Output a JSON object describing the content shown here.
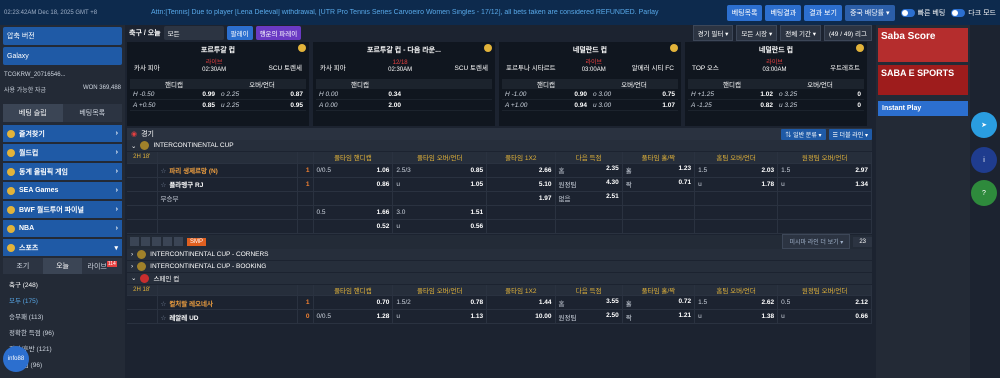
{
  "topbar": {
    "clock": "02:23:42AM Dec 18, 2025 GMT +8",
    "ticker": "Attn:[Tennis] Due to player [Lena Deleval] withdrawal, [UTR Pro Tennis Series Carvoeiro Women Singles - 17/12], all bets taken are considered REFUNDED. Parlay",
    "btns": [
      "베팅목록",
      "베팅결과",
      "결과 보기",
      "중국 배당률 ▾"
    ],
    "toggle1": "빠른 베팅",
    "toggle2": "다크 모드"
  },
  "sidebar": {
    "compress": "압축 버전",
    "galaxy": "Galaxy",
    "user": "TCGKRW_20716546...",
    "balance_label": "사용 가능한 자금",
    "balance": "WON 369,488",
    "tab1": "베팅 슬립",
    "tab2": "베팅목록",
    "menu": [
      "즐겨찾기",
      "월드컵",
      "동계 올림픽 게임",
      "SEA Games",
      "BWF 월드투어 파이널",
      "NBA",
      "스포츠"
    ],
    "subtabs": [
      "조기",
      "오늘",
      "라이브"
    ],
    "live_count": "114",
    "sub": [
      "축구 (248)",
      "모두 (175)",
      "승무패 (113)",
      "정확한 득점 (96)",
      "전반/후반 (121)",
      "홀 득점 (96)"
    ]
  },
  "center": {
    "sport": "축구 / 오늘",
    "filter": "모든",
    "pills": [
      "팔레이",
      "행운의 파레이"
    ],
    "right": [
      "경기 필터 ▾",
      "모든 시장 ▾",
      "전체 기간 ▾",
      "(49 / 49) 리그"
    ],
    "cards": [
      {
        "league": "포르투갈 컵",
        "home": "카사 피아",
        "away": "SCU 토렌세",
        "status": "라이브",
        "time": "02:30AM",
        "hd1": "핸디캡",
        "hd2": "오버/언더",
        "r1": [
          "H -0.50",
          "0.99",
          "o 2.25",
          "0.87"
        ],
        "r2": [
          "A +0.50",
          "0.85",
          "u 2.25",
          "0.95"
        ]
      },
      {
        "league": "포르투갈 컵 - 다음 라운...",
        "home": "카사 피아",
        "away": "SCU 토렌세",
        "status": "12/18",
        "time": "02:30AM",
        "hd1": "핸디캡",
        "hd2": "",
        "r1": [
          "H 0.00",
          "0.34",
          "",
          ""
        ],
        "r2": [
          "A 0.00",
          "2.00",
          "",
          ""
        ]
      },
      {
        "league": "네덜란드 컵",
        "home": "포르투나 시타르트",
        "away": "알메러 시티 FC",
        "status": "라이브",
        "time": "03:00AM",
        "hd1": "핸디캡",
        "hd2": "오버/언더",
        "r1": [
          "H -1.00",
          "0.90",
          "o 3.00",
          "0.75"
        ],
        "r2": [
          "A +1.00",
          "0.94",
          "u 3.00",
          "1.07"
        ]
      },
      {
        "league": "네덜란드 컵",
        "home": "TOP 오스",
        "away": "우트레흐트",
        "status": "라이브",
        "time": "03:00AM",
        "hd1": "핸디캡",
        "hd2": "오버/언더",
        "r1": [
          "H +1.25",
          "1.02",
          "o 3.25",
          "0"
        ],
        "r2": [
          "A -1.25",
          "0.82",
          "u 3.25",
          "0"
        ]
      }
    ],
    "section": "경기",
    "sort1": "⇅ 일반 분류 ▾",
    "sort2": "☰ 더블 라인 ▾",
    "leagues": [
      "INTERCONTINENTAL CUP",
      "INTERCONTINENTAL CUP - CORNERS",
      "INTERCONTINENTAL CUP - BOOKING",
      "스페인 컵"
    ],
    "headers": [
      "풀타임 핸디캡",
      "풀타임 오버/언더",
      "풀타임 1X2",
      "다음 득점",
      "풀타임 홀/짝",
      "홈팀 오버/언더",
      "원정팀 오버/언더"
    ],
    "m1": {
      "live": "2H 18'",
      "home": "파리 생제르망 (N)",
      "away": "플라멩구 RJ",
      "draw": "무승부",
      "hs": "1",
      "as": "1",
      "rows": [
        [
          "0/0.5",
          "1.06",
          "2.5/3",
          "0.85",
          "2.66",
          "홈",
          "2.35",
          "홀",
          "1.23",
          "1.5",
          "2.03",
          "1.5",
          "2.97"
        ],
        [
          "",
          "0.86",
          "u",
          "1.05",
          "5.10",
          "원정팀",
          "4.30",
          "짝",
          "0.71",
          "u",
          "1.78",
          "u",
          "1.34"
        ],
        [
          "",
          "",
          "",
          "",
          "1.97",
          "없음",
          "2.51",
          "",
          "",
          "",
          "",
          "",
          ""
        ],
        [
          "0.5",
          "1.66",
          "3.0",
          "1.51",
          "",
          "",
          "",
          "",
          "",
          "",
          "",
          "",
          ""
        ],
        [
          "",
          "0.52",
          "u",
          "0.56",
          "",
          "",
          "",
          "",
          "",
          "",
          "",
          "",
          ""
        ]
      ]
    },
    "more": "미시마 라인 더 보기 ▾",
    "more_count": "23",
    "m2": {
      "live": "2H 18'",
      "home": "컬처랄 레오네사",
      "away": "레알레 UD",
      "hs": "1",
      "as": "0",
      "rows": [
        [
          "",
          "0.70",
          "1.5/2",
          "0.78",
          "1.44",
          "홈",
          "3.55",
          "홀",
          "0.72",
          "1.5",
          "2.62",
          "0.5",
          "2.12"
        ],
        [
          "0/0.5",
          "1.28",
          "u",
          "1.13",
          "10.00",
          "원정팀",
          "2.50",
          "짝",
          "1.21",
          "u",
          "1.38",
          "u",
          "0.66"
        ]
      ]
    }
  },
  "right": {
    "banner1": "Saba Score",
    "banner2": "SABA E SPORTS",
    "instant": "Instant Play",
    "float": [
      "telegram",
      "info88",
      "help"
    ],
    "avatar": "info88"
  }
}
